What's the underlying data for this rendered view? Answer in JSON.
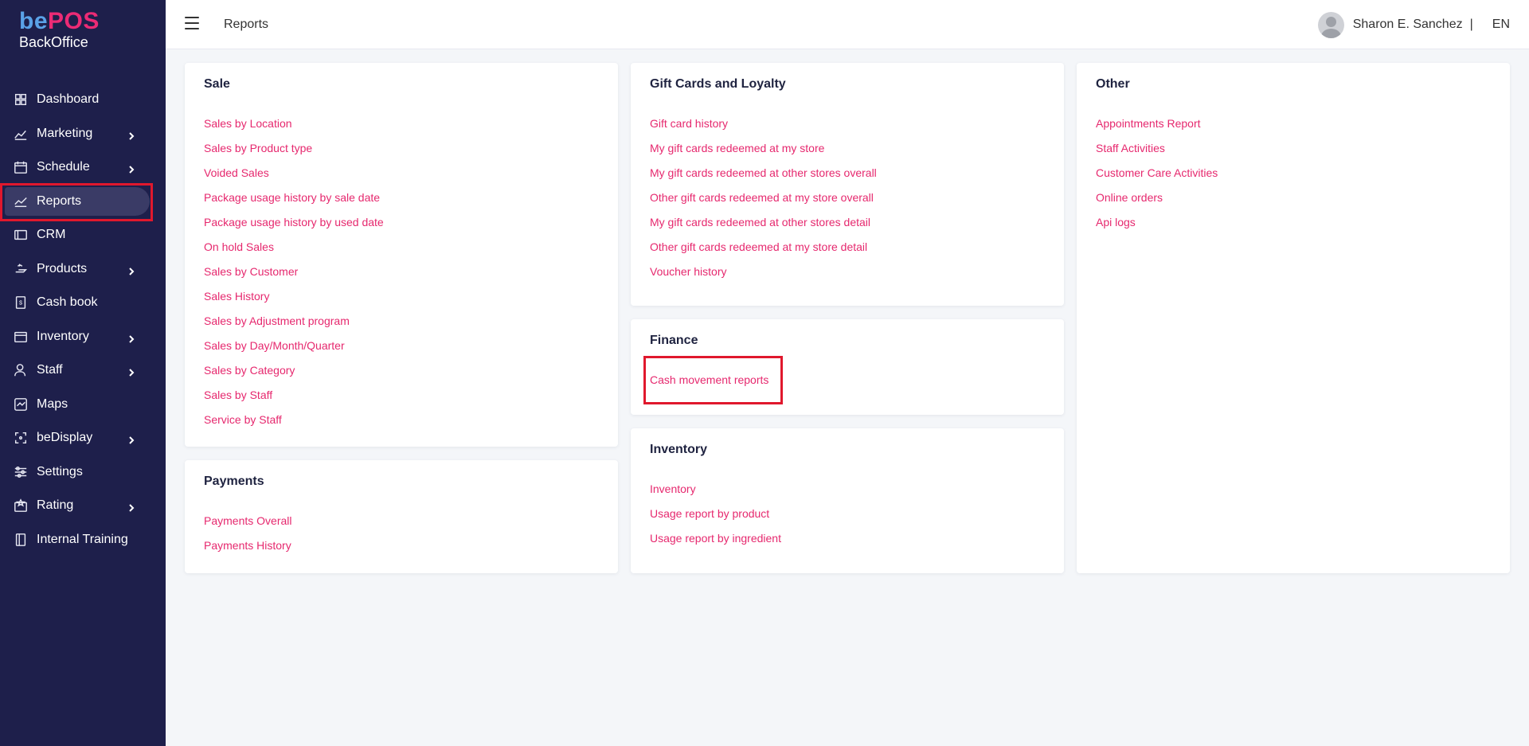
{
  "brand": {
    "logo_be": "be",
    "logo_pos": "POS",
    "logo_sub": "BackOffice"
  },
  "sidebar": {
    "items": [
      {
        "label": "Dashboard",
        "icon": "dashboard-grid-icon",
        "chevron": false
      },
      {
        "label": "Marketing",
        "icon": "marketing-chart-icon",
        "chevron": true
      },
      {
        "label": "Schedule",
        "icon": "calendar-icon",
        "chevron": true
      },
      {
        "label": "Reports",
        "icon": "reports-line-icon",
        "chevron": false,
        "active": true
      },
      {
        "label": "CRM",
        "icon": "crm-card-icon",
        "chevron": false
      },
      {
        "label": "Products",
        "icon": "products-icon",
        "chevron": true
      },
      {
        "label": "Cash book",
        "icon": "cash-book-icon",
        "chevron": false
      },
      {
        "label": "Inventory",
        "icon": "inventory-box-icon",
        "chevron": true
      },
      {
        "label": "Staff",
        "icon": "staff-person-icon",
        "chevron": true
      },
      {
        "label": "Maps",
        "icon": "maps-icon",
        "chevron": false
      },
      {
        "label": "beDisplay",
        "icon": "bedisplay-scan-icon",
        "chevron": true
      },
      {
        "label": "Settings",
        "icon": "settings-sliders-icon",
        "chevron": false
      },
      {
        "label": "Rating",
        "icon": "rating-star-icon",
        "chevron": true
      },
      {
        "label": "Internal Training",
        "icon": "training-book-icon",
        "chevron": false
      }
    ]
  },
  "header": {
    "title": "Reports",
    "user_name": "Sharon E. Sanchez",
    "separator": "|",
    "language": "EN"
  },
  "cards": {
    "sale": {
      "title": "Sale",
      "links": [
        "Sales by Location",
        "Sales by Product type",
        "Voided Sales",
        "Package usage history by sale date",
        "Package usage history by used date",
        "On hold Sales",
        "Sales by Customer",
        "Sales History",
        "Sales by Adjustment program",
        "Sales by Day/Month/Quarter",
        "Sales by Category",
        "Sales by Staff",
        "Service by Staff"
      ]
    },
    "payments": {
      "title": "Payments",
      "links": [
        "Payments Overall",
        "Payments History"
      ]
    },
    "giftcards": {
      "title": "Gift Cards and Loyalty",
      "links": [
        "Gift card history",
        "My gift cards redeemed at my store",
        "My gift cards redeemed at other stores overall",
        "Other gift cards redeemed at my store overall",
        "My gift cards redeemed at other stores detail",
        "Other gift cards redeemed at my store detail",
        "Voucher history"
      ]
    },
    "finance": {
      "title": "Finance",
      "links": [
        "Cash movement reports"
      ]
    },
    "inventory": {
      "title": "Inventory",
      "links": [
        "Inventory",
        "Usage report by product",
        "Usage report by ingredient"
      ]
    },
    "other": {
      "title": "Other",
      "links": [
        "Appointments Report",
        "Staff Activities",
        "Customer Care Activities",
        "Online orders",
        "Api logs"
      ]
    }
  },
  "colors": {
    "sidebar_bg": "#1e1f4b",
    "link": "#e6286e",
    "highlight": "#e0182d",
    "logo_be": "#5aa2e8",
    "logo_pos": "#ec2b75"
  }
}
